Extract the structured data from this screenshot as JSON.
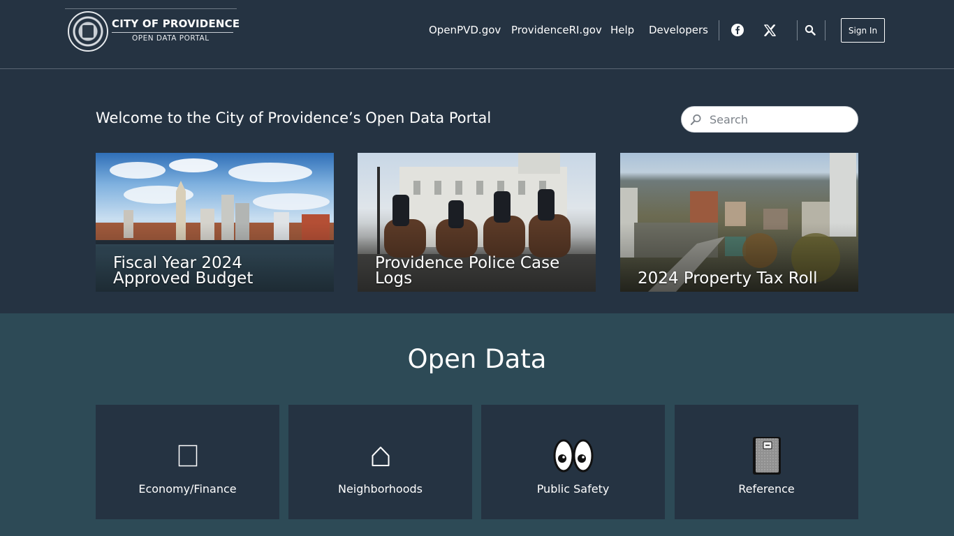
{
  "header": {
    "logo_title": "CITY OF PROVIDENCE",
    "logo_subtitle": "OPEN DATA PORTAL",
    "nav": [
      "OpenPVD.gov",
      "ProvidenceRI.gov",
      "Help",
      "Developers"
    ],
    "social_icons": [
      "facebook-icon",
      "x-icon"
    ],
    "signin_label": "Sign In"
  },
  "hero": {
    "welcome": "Welcome to the City of Providence’s Open Data Portal",
    "search_placeholder": "Search",
    "cards": [
      {
        "title": "Fiscal Year 2024 Approved Budget"
      },
      {
        "title": "Providence Police Case Logs"
      },
      {
        "title": "2024 Property Tax Roll"
      }
    ]
  },
  "open_data": {
    "title": "Open Data",
    "categories": [
      {
        "label": "Economy/Finance",
        "icon": "finance-icon"
      },
      {
        "label": "Neighborhoods",
        "icon": "house-icon"
      },
      {
        "label": "Public Safety",
        "icon": "eyes-icon"
      },
      {
        "label": "Reference",
        "icon": "book-icon"
      }
    ]
  },
  "colors": {
    "header_bg": "#253342",
    "section_bg": "#2d4a56",
    "tile_bg": "#253342"
  }
}
